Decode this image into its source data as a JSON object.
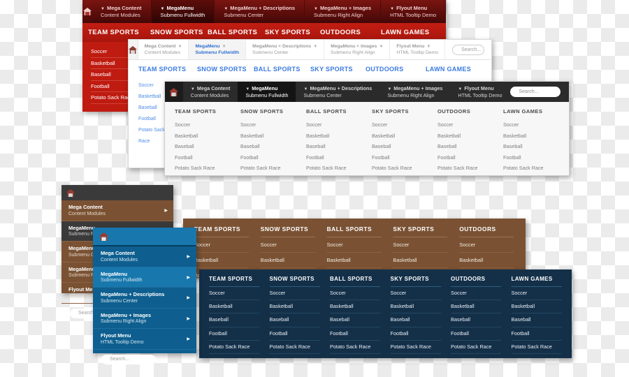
{
  "shared": {
    "tabs": [
      {
        "title": "Mega Content",
        "subtitle": "Content Modules"
      },
      {
        "title": "MegaMenu",
        "subtitle": "Submenu Fullwidth"
      },
      {
        "title": "MegaMenu + Descriptions",
        "subtitle": "Submenu Center"
      },
      {
        "title": "MegaMenu + Images",
        "subtitle": "Submenu Right Align"
      },
      {
        "title": "Flyout Menu",
        "subtitle": "HTML Tooltip Demo"
      }
    ],
    "categories": [
      "TEAM SPORTS",
      "SNOW SPORTS",
      "BALL SPORTS",
      "SKY SPORTS",
      "OUTDOORS",
      "LAWN GAMES"
    ],
    "items": [
      "Soccer",
      "Basketball",
      "Baseball",
      "Football",
      "Potato Sack Race"
    ],
    "search_placeholder": "Search...",
    "home_icon": "home-icon",
    "caret_icon": "caret-down-icon",
    "arrow_icon": "caret-right-icon",
    "active_tab_index": 1
  },
  "panels": {
    "red": {
      "name": "red-megamenu",
      "accent": "#bf1b11",
      "bar_color": "#440807",
      "nav_color": "#ffffff"
    },
    "white": {
      "name": "white-megamenu",
      "accent": "#3b7ae0",
      "bar_color": "#ffffff"
    },
    "dark": {
      "name": "dark-megamenu",
      "accent": "#2b2b2b",
      "bar_color": "#141414"
    },
    "brown_vertical": {
      "name": "brown-vertical-menu",
      "accent": "#7a5233"
    },
    "brown_mega": {
      "name": "brown-megamenu",
      "accent": "#7a5233"
    },
    "blue_vertical": {
      "name": "blue-vertical-menu",
      "accent": "#0e5f8f"
    },
    "navy_mega": {
      "name": "navy-megamenu",
      "accent": "#143049"
    }
  }
}
